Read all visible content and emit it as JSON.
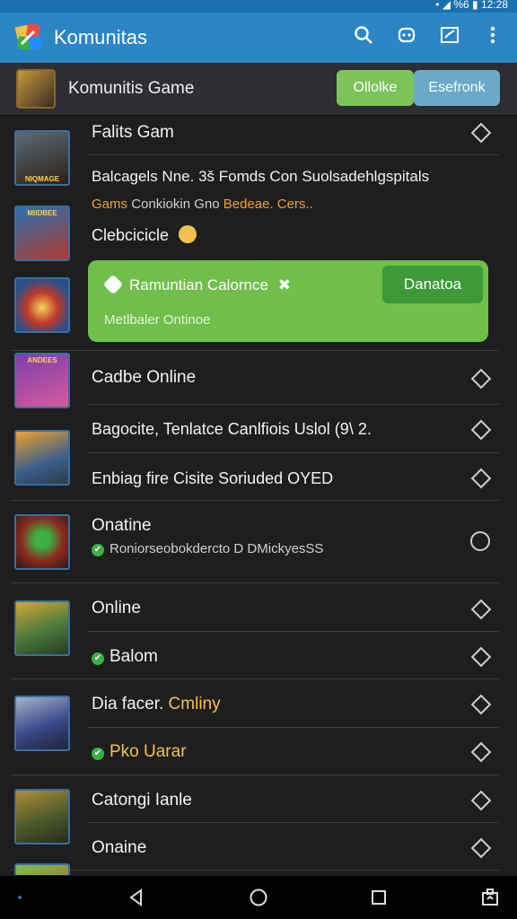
{
  "status": {
    "right_text": "• ◢ %6 ▮ 12:28"
  },
  "app": {
    "title": "Komunitas"
  },
  "subheader": {
    "title": "Komunitis Game",
    "online_btn": "Ollolke",
    "other_btn": "Esefronk"
  },
  "rows": {
    "r1": "Falits Gam",
    "r2": "Balcagels Nne. 3š Fomds Con Suolsadehlgspitals",
    "r2b_a": "Gams",
    "r2b_b": "Conkiokin Gno",
    "r2b_c": "Bedeae. Cers..",
    "r3": "Clebcicicle",
    "r4": "Cadbe Online",
    "r5": "Bagocite, Tenlatce Canlfiois Uslol (9\\ 2.",
    "r6": "Enbiag fire Cisite Soriuded OYED",
    "r7": "Onatine",
    "r7sub": "Roniorseobokdercto D DMickyesSS",
    "r8": "Online",
    "r9": "Balom",
    "r10a": "Dia facer.",
    "r10b": "Cmliny",
    "r11": "Pko Uarar",
    "r12": "Catongi Ianle",
    "r13": "Onaine"
  },
  "thumbs": {
    "t1": "NIQMAGE",
    "t2": "MIIDBEE",
    "t4": "ANDEES"
  },
  "banner": {
    "title": "Ramuntian Calornce",
    "sub": "Metlbaler Ontinoe",
    "button": "Danatoa"
  },
  "colors": {
    "appbar": "#2b86c6",
    "online": "#7cc35a",
    "banner": "#6fbf4a",
    "accent_orange": "#f0a030"
  }
}
